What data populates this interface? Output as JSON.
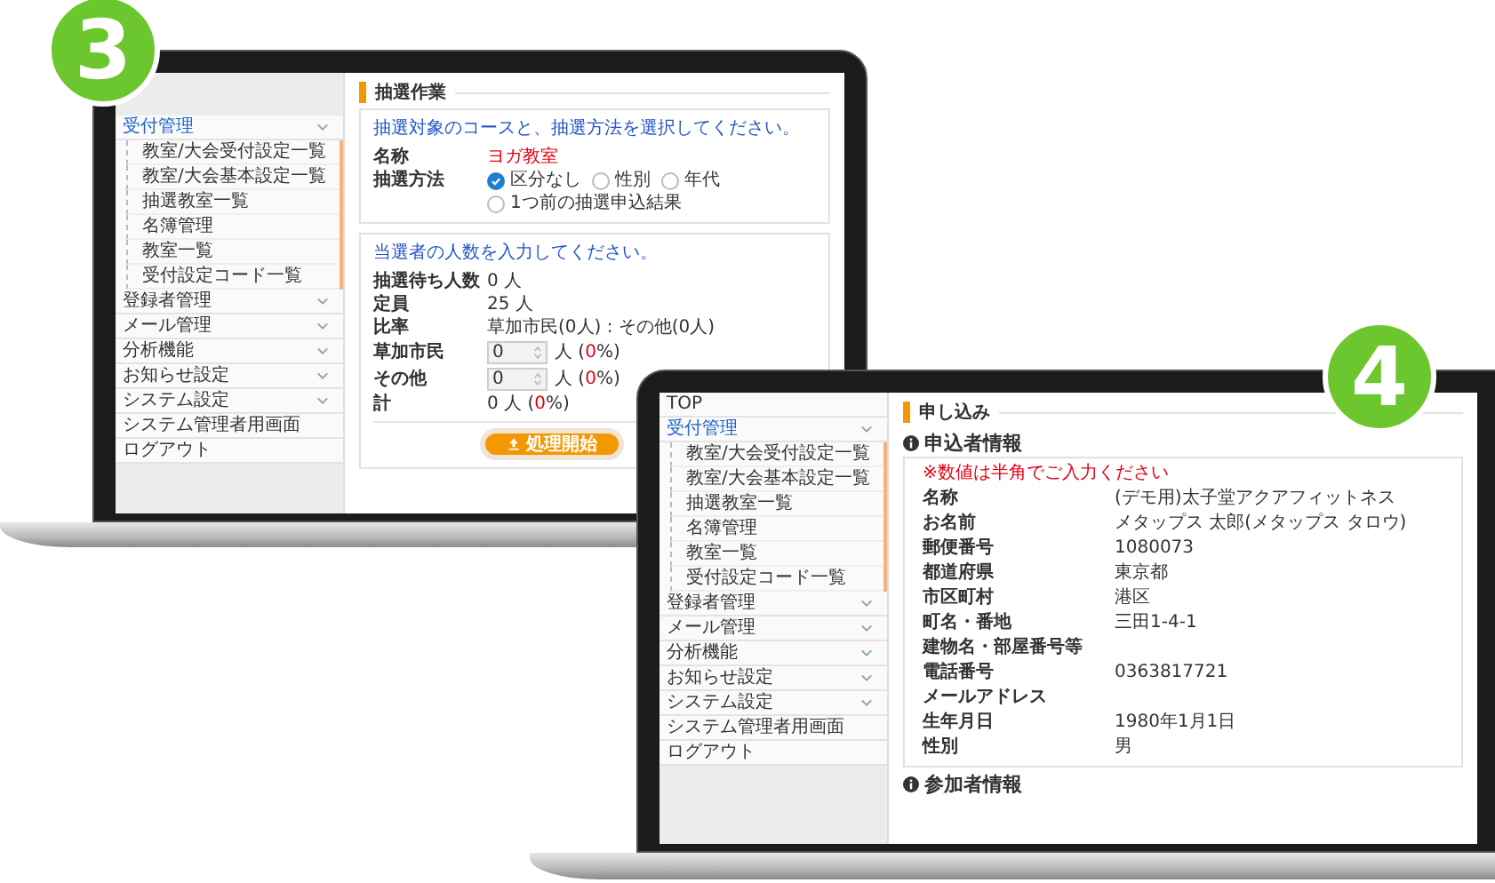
{
  "screens": [
    {
      "kind": "lottery",
      "badge": "3",
      "sidebar": [
        {
          "kind": "menu",
          "label": "受付管理",
          "selected": true,
          "children": [
            {
              "label": "教室/大会受付設定一覧",
              "selected": false
            },
            {
              "label": "教室/大会基本設定一覧",
              "selected": false
            },
            {
              "label": "抽選教室一覧",
              "selected": false
            },
            {
              "label": "名簿管理",
              "selected": false
            },
            {
              "label": "教室一覧",
              "selected": false
            },
            {
              "label": "受付設定コード一覧",
              "selected": false
            }
          ]
        },
        {
          "kind": "menu",
          "label": "登録者管理",
          "selected": false
        },
        {
          "kind": "menu",
          "label": "メール管理",
          "selected": false
        },
        {
          "kind": "menu",
          "label": "分析機能",
          "selected": false
        },
        {
          "kind": "menu",
          "label": "お知らせ設定",
          "selected": false
        },
        {
          "kind": "menu",
          "label": "システム設定",
          "selected": false
        },
        {
          "kind": "link",
          "label": "システム管理者用画面",
          "selected": false
        },
        {
          "kind": "link",
          "label": "ログアウト",
          "selected": false
        }
      ],
      "title": "抽選作業",
      "course_panel": {
        "instruction": "抽選対象のコースと、抽選方法を選択してください。",
        "name_label": "名称",
        "name_value": "ヨガ教室",
        "method_label": "抽選方法",
        "methods": [
          {
            "label": "区分なし",
            "selected": true
          },
          {
            "label": "性別",
            "selected": false
          },
          {
            "label": "年代",
            "selected": false
          },
          {
            "label": "1つ前の抽選申込結果",
            "selected": false
          }
        ]
      },
      "count_panel": {
        "instruction": "当選者の人数を入力してください。",
        "rows": [
          {
            "kind": "text",
            "label": "抽選待ち人数",
            "value": "0 人"
          },
          {
            "kind": "text",
            "label": "定員",
            "value": "25 人"
          },
          {
            "kind": "text",
            "label": "比率",
            "value": "草加市民(0人) : その他(0人)"
          },
          {
            "kind": "input",
            "label": "草加市民",
            "value": "0",
            "before": "人 (",
            "percent": "0",
            "after": "%)"
          },
          {
            "kind": "input",
            "label": "その他",
            "value": "0",
            "before": "人 (",
            "percent": "0",
            "after": "%)"
          },
          {
            "kind": "total",
            "label": "計",
            "before": "0 人 (",
            "percent": "0",
            "after": "%)"
          }
        ],
        "button": "処理開始"
      }
    },
    {
      "kind": "application",
      "badge": "4",
      "sidebar": [
        {
          "kind": "link",
          "label": "TOP",
          "selected": false
        },
        {
          "kind": "menu",
          "label": "受付管理",
          "selected": true,
          "children": [
            {
              "label": "教室/大会受付設定一覧",
              "selected": false
            },
            {
              "label": "教室/大会基本設定一覧",
              "selected": false
            },
            {
              "label": "抽選教室一覧",
              "selected": false
            },
            {
              "label": "名簿管理",
              "selected": false
            },
            {
              "label": "教室一覧",
              "selected": false
            },
            {
              "label": "受付設定コード一覧",
              "selected": false
            }
          ]
        },
        {
          "kind": "menu",
          "label": "登録者管理",
          "selected": false
        },
        {
          "kind": "menu",
          "label": "メール管理",
          "selected": false
        },
        {
          "kind": "menu",
          "label": "分析機能",
          "selected": false
        },
        {
          "kind": "menu",
          "label": "お知らせ設定",
          "selected": false
        },
        {
          "kind": "menu",
          "label": "システム設定",
          "selected": false
        },
        {
          "kind": "link",
          "label": "システム管理者用画面",
          "selected": false
        },
        {
          "kind": "link",
          "label": "ログアウト",
          "selected": false
        }
      ],
      "title": "申し込み",
      "section": "申込者情報",
      "note": "※数値は半角でご入力ください",
      "fields": [
        {
          "label": "名称",
          "value": "(デモ用)太子堂アクアフィットネス"
        },
        {
          "label": "お名前",
          "value": "メタップス 太郎(メタップス タロウ)"
        },
        {
          "label": "郵便番号",
          "value": "1080073"
        },
        {
          "label": "都道府県",
          "value": "東京都"
        },
        {
          "label": "市区町村",
          "value": "港区"
        },
        {
          "label": "町名・番地",
          "value": "三田1-4-1"
        },
        {
          "label": "建物名・部屋番号等"
        },
        {
          "label": "電話番号",
          "value": "0363817721"
        },
        {
          "label": "メールアドレス"
        },
        {
          "label": "生年月日",
          "value": "1980年1月1日"
        },
        {
          "label": "性別",
          "value": "男"
        }
      ],
      "next_section": "参加者情報"
    }
  ]
}
